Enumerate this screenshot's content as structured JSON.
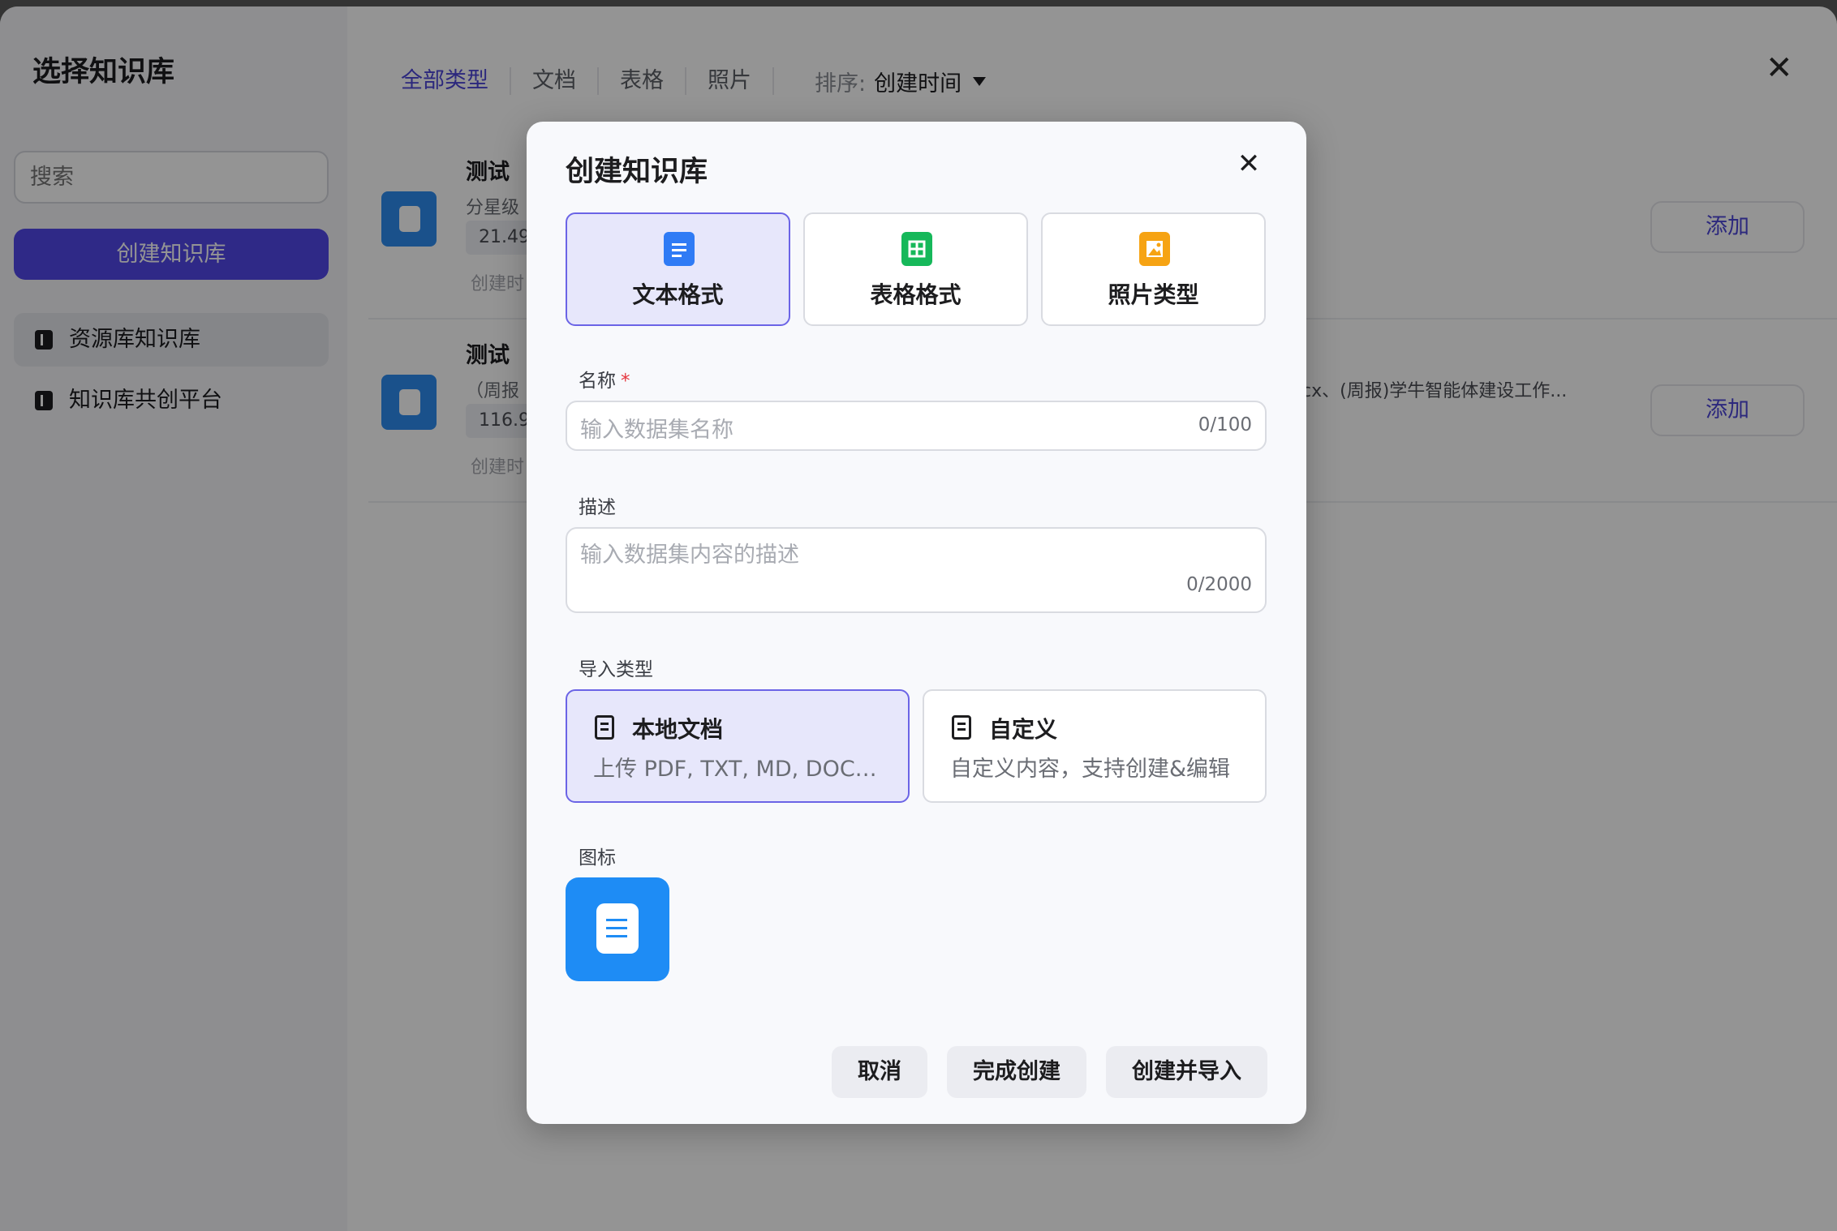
{
  "panel": {
    "title": "选择知识库",
    "search_placeholder": "搜索",
    "create_button": "创建知识库",
    "sidebar": [
      {
        "label": "资源库知识库",
        "active": true
      },
      {
        "label": "知识库共创平台",
        "active": false
      }
    ],
    "tabs": [
      "全部类型",
      "文档",
      "表格",
      "照片"
    ],
    "sort_label": "排序:",
    "sort_value": "创建时间",
    "close_icon": "✕",
    "items": [
      {
        "name": "测试",
        "desc": "分星级",
        "size": "21.49",
        "time": "创建时",
        "extra": "",
        "add": "添加"
      },
      {
        "name": "测试",
        "desc": "（周报",
        "size": "116.9",
        "time": "创建时",
        "extra": "cx、(周报)学牛智能体建设工作...",
        "add": "添加"
      }
    ]
  },
  "modal": {
    "title": "创建知识库",
    "close_icon": "✕",
    "formats": [
      {
        "label": "文本格式",
        "icon": "doc-icon",
        "color": "#2f7bf5",
        "selected": true
      },
      {
        "label": "表格格式",
        "icon": "table-icon",
        "color": "#16b85a",
        "selected": false
      },
      {
        "label": "照片类型",
        "icon": "image-icon",
        "color": "#f6a313",
        "selected": false
      }
    ],
    "name_label": "名称",
    "name_required": "*",
    "name_placeholder": "输入数据集名称",
    "name_count": "0/100",
    "desc_label": "描述",
    "desc_placeholder": "输入数据集内容的描述",
    "desc_count": "0/2000",
    "import_label": "导入类型",
    "imports": [
      {
        "title": "本地文档",
        "sub": "上传 PDF, TXT, MD, DOC…",
        "selected": true
      },
      {
        "title": "自定义",
        "sub": "自定义内容，支持创建&编辑",
        "selected": false
      }
    ],
    "icon_label": "图标",
    "buttons": {
      "cancel": "取消",
      "finish": "完成创建",
      "create_import": "创建并导入"
    }
  }
}
